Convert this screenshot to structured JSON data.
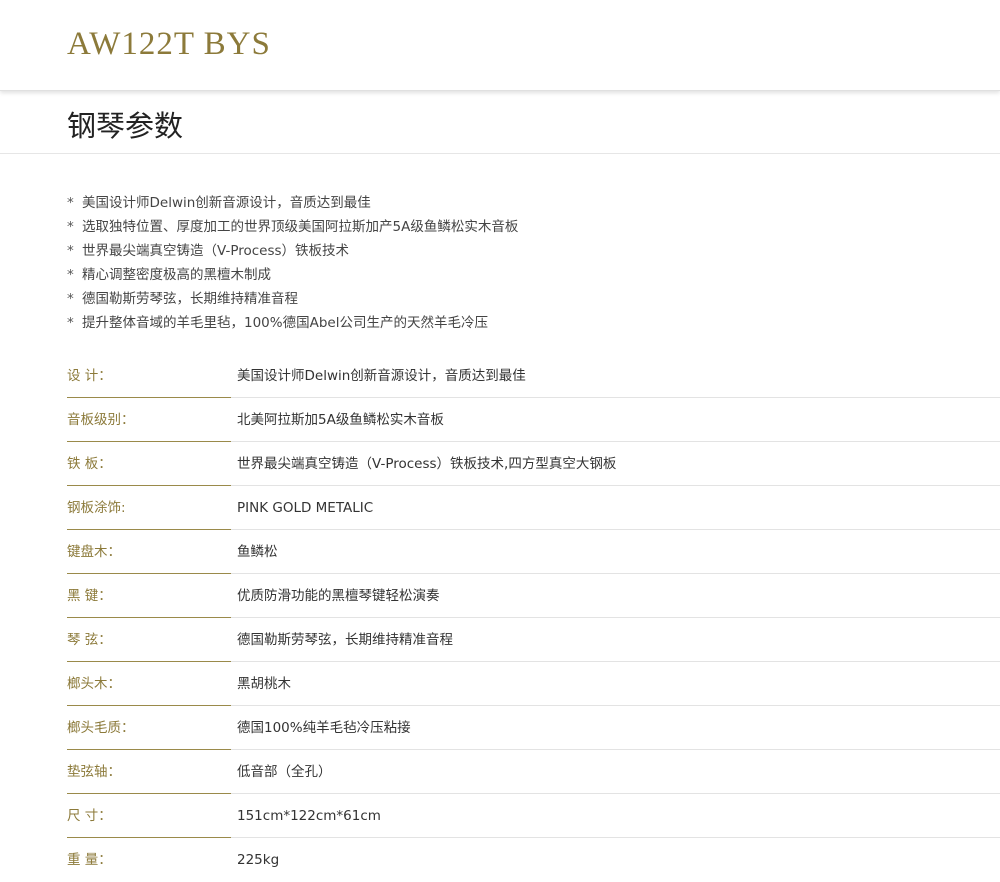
{
  "header": {
    "model": "AW122T BYS"
  },
  "section": {
    "title": "钢琴参数"
  },
  "features": [
    "美国设计师Delwin创新音源设计，音质达到最佳",
    "选取独特位置、厚度加工的世界顶级美国阿拉斯加产5A级鱼鳞松实木音板",
    "世界最尖端真空铸造（V-Process）铁板技术",
    "精心调整密度极高的黑檀木制成",
    "德国勒斯劳琴弦，长期维持精准音程",
    "提升整体音域的羊毛里毡，100%德国Abel公司生产的天然羊毛冷压"
  ],
  "specs": [
    {
      "label": "设 计：",
      "value": "美国设计师Delwin创新音源设计，音质达到最佳"
    },
    {
      "label": "音板级别：",
      "value": "北美阿拉斯加5A级鱼鳞松实木音板"
    },
    {
      "label": "铁 板：",
      "value": "世界最尖端真空铸造（V-Process）铁板技术,四方型真空大钢板"
    },
    {
      "label": "钢板涂饰:",
      "value": "PINK GOLD METALIC"
    },
    {
      "label": "键盘木：",
      "value": "鱼鳞松"
    },
    {
      "label": "黑 键：",
      "value": "优质防滑功能的黑檀琴键轻松演奏"
    },
    {
      "label": "琴 弦：",
      "value": "德国勒斯劳琴弦，长期维持精准音程"
    },
    {
      "label": "榔头木：",
      "value": "黑胡桃木"
    },
    {
      "label": "榔头毛质：",
      "value": "德国100%纯羊毛毡冷压粘接"
    },
    {
      "label": "垫弦轴：",
      "value": "低音部（全孔）"
    },
    {
      "label": "尺 寸：",
      "value": "151cm*122cm*61cm"
    },
    {
      "label": "重 量：",
      "value": "225kg"
    }
  ],
  "colors": {
    "accent": "#8c7a3a",
    "text": "#333333",
    "divider": "#e3e3e3"
  }
}
